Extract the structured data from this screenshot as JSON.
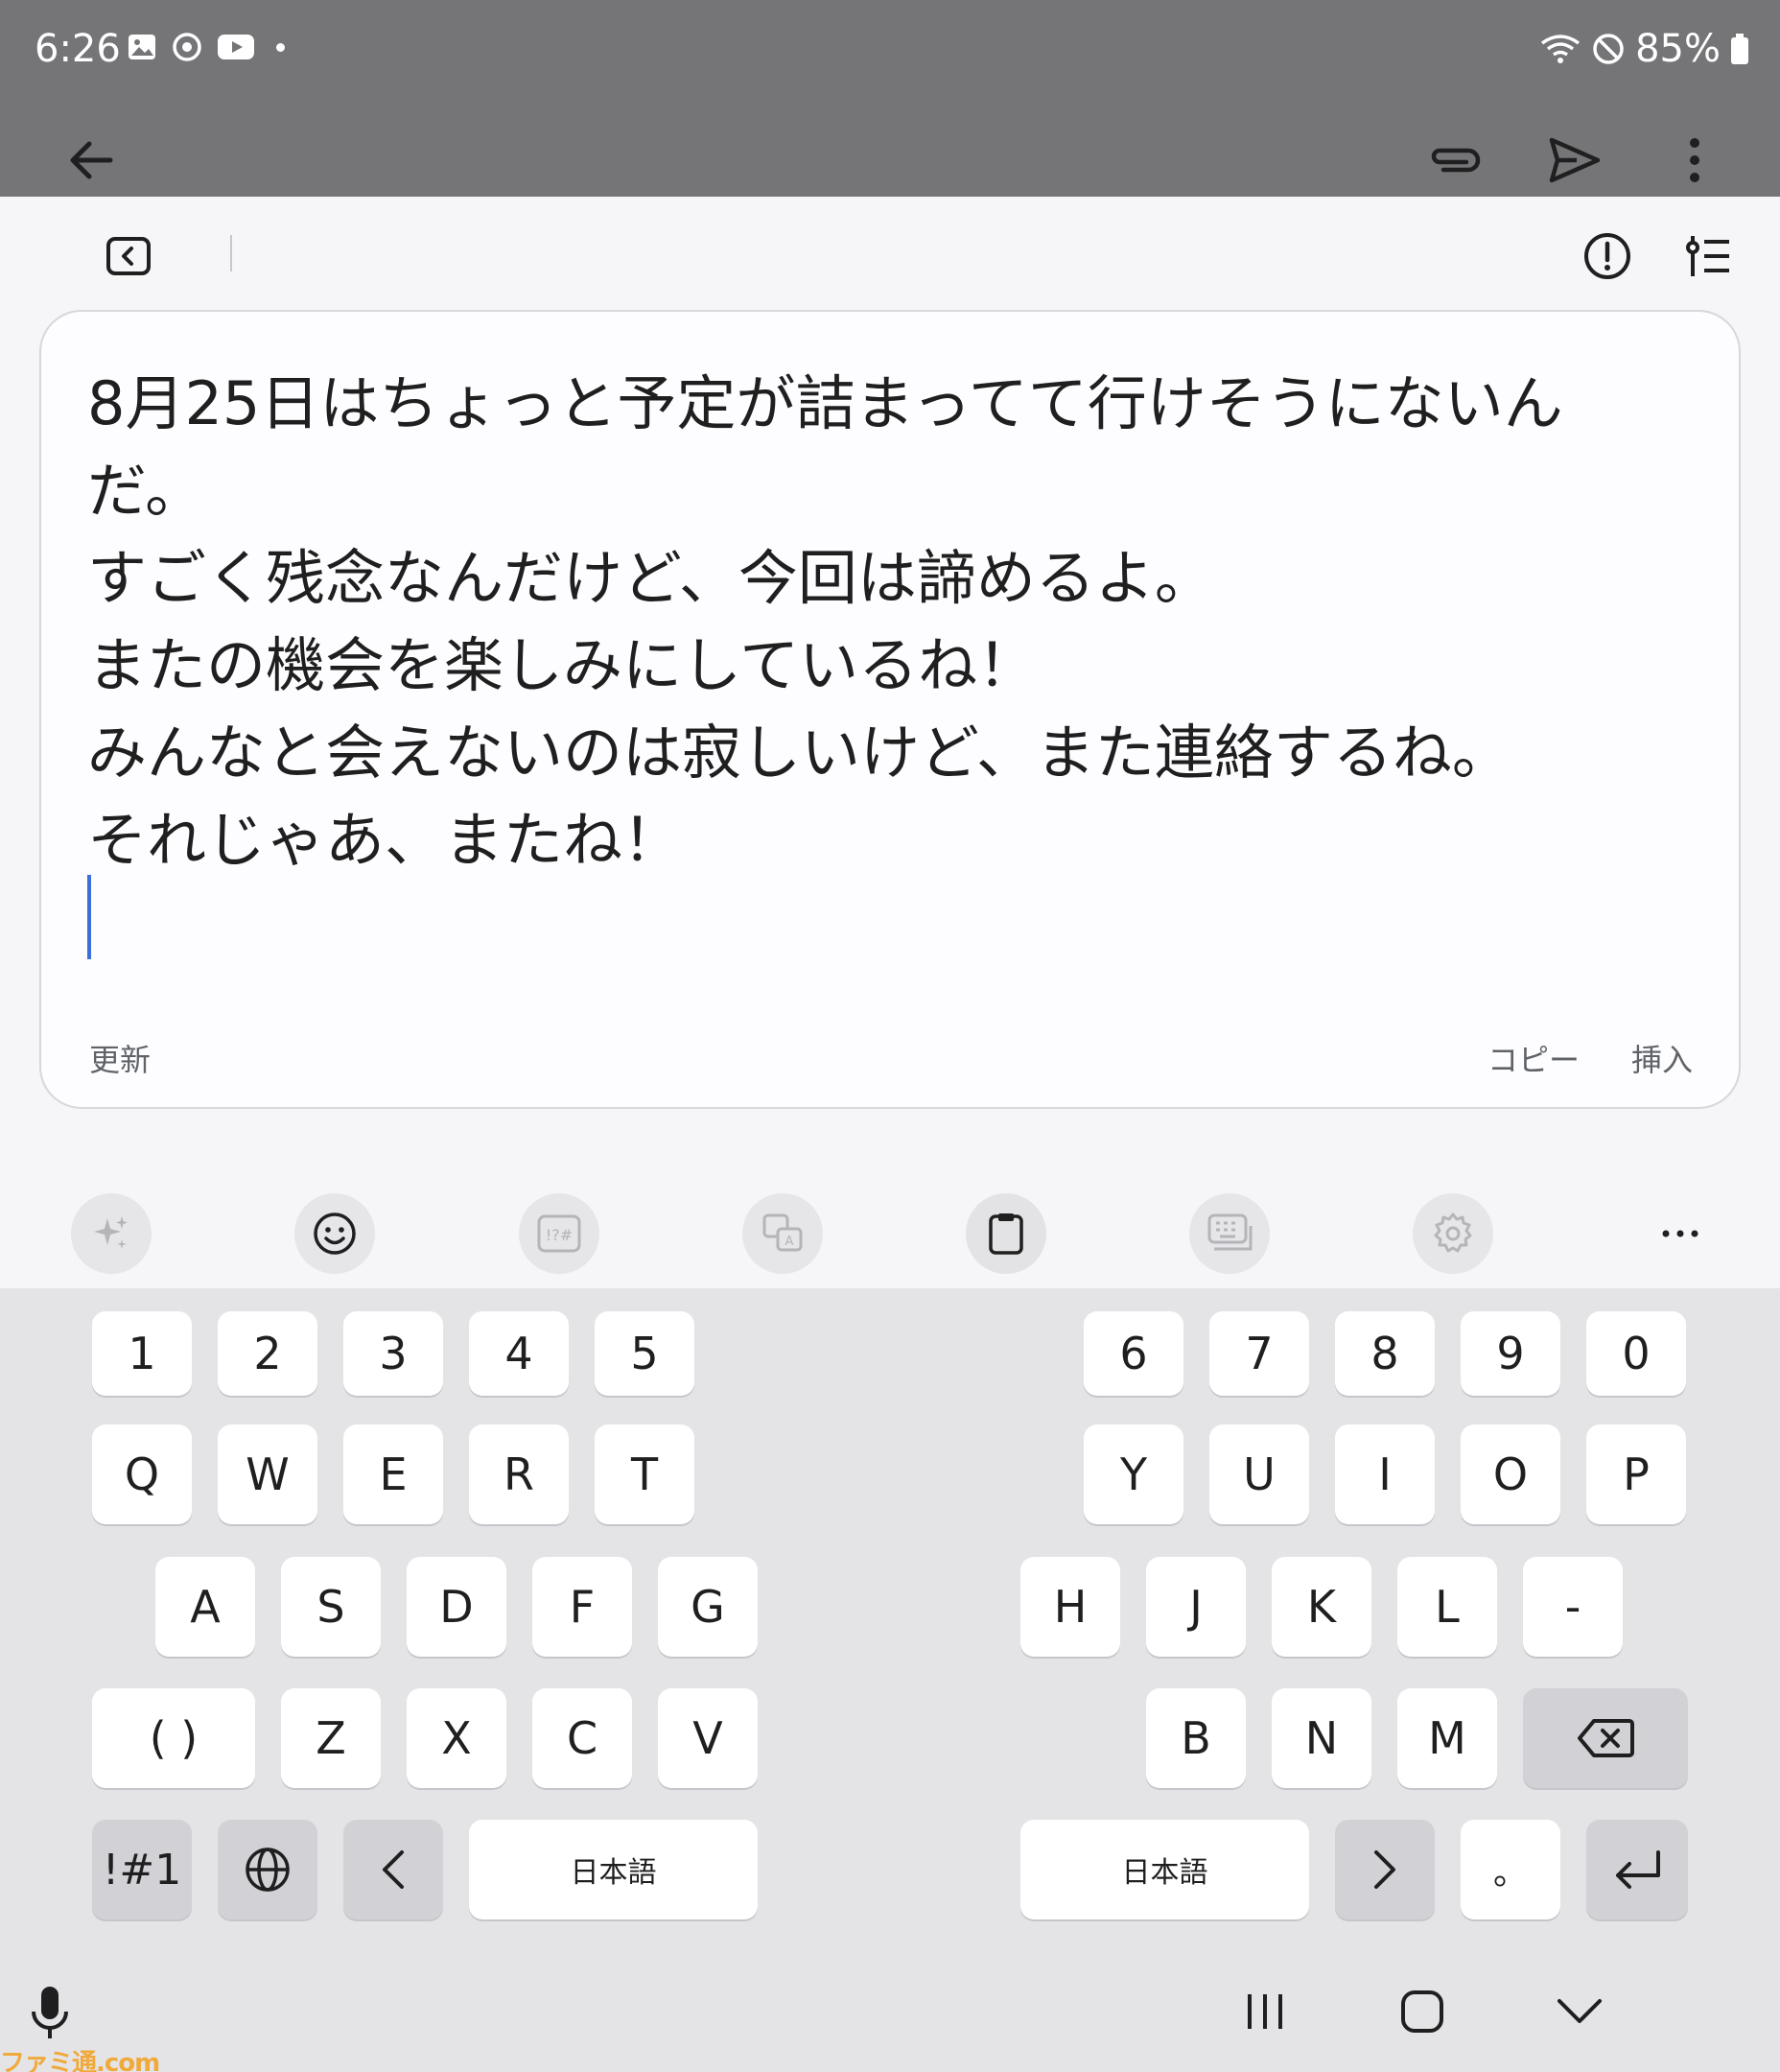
{
  "status_bar": {
    "time": "6:26",
    "battery": "85%",
    "left_icons": [
      "image-icon",
      "sync-icon",
      "youtube-icon",
      "dot-icon"
    ],
    "right_icons": [
      "wifi-icon",
      "do-not-disturb-icon",
      "battery-icon"
    ]
  },
  "app_bar": {
    "icons": [
      "back-arrow-icon",
      "paperclip-icon",
      "send-icon",
      "more-vert-icon"
    ]
  },
  "toolbar": {
    "icons": [
      "collapse-panel-icon",
      "alert-icon",
      "tone-settings-icon"
    ]
  },
  "writing_card": {
    "lines": [
      "8月25日はちょっと予定が詰まってて行けそうにないん",
      "だ。",
      "すごく残念なんだけど、今回は諦めるよ。",
      "またの機会を楽しみにしているね！",
      "みんなと会えないのは寂しいけど、また連絡するね。",
      "それじゃあ、またね！"
    ],
    "update_label": "更新",
    "copy_label": "コピー",
    "insert_label": "挿入",
    "caret_color": "#3c6fd9"
  },
  "keyboard_toolbar": {
    "tools": [
      "ai-sparkle-icon",
      "emoji-icon",
      "symbols-icon",
      "translate-icon",
      "clipboard-icon",
      "keyboard-mode-icon",
      "settings-icon",
      "more-horiz-icon"
    ]
  },
  "keyboard": {
    "left": {
      "row1": [
        "1",
        "2",
        "3",
        "4",
        "5"
      ],
      "row2": [
        "Q",
        "W",
        "E",
        "R",
        "T"
      ],
      "row3": [
        "A",
        "S",
        "D",
        "F",
        "G"
      ],
      "row4": [
        "( )",
        "Z",
        "X",
        "C",
        "V"
      ],
      "symbols_key": "!#1",
      "lang_key": "日本語"
    },
    "right": {
      "row1": [
        "6",
        "7",
        "8",
        "9",
        "0"
      ],
      "row2": [
        "Y",
        "U",
        "I",
        "O",
        "P"
      ],
      "row3": [
        "H",
        "J",
        "K",
        "L",
        "-"
      ],
      "row4": [
        "B",
        "N",
        "M"
      ],
      "lang_key": "日本語",
      "punct_key": "。"
    }
  },
  "nav_bar": {
    "icons": [
      "mic-icon",
      "recent-apps-icon",
      "home-icon",
      "hide-keyboard-icon"
    ]
  },
  "watermark": "ファミ通.com",
  "colors": {
    "app_bar": "#757578",
    "background": "#f6f6f8",
    "keyboard": "#e4e4e7",
    "accent": "#3c6fd9"
  }
}
